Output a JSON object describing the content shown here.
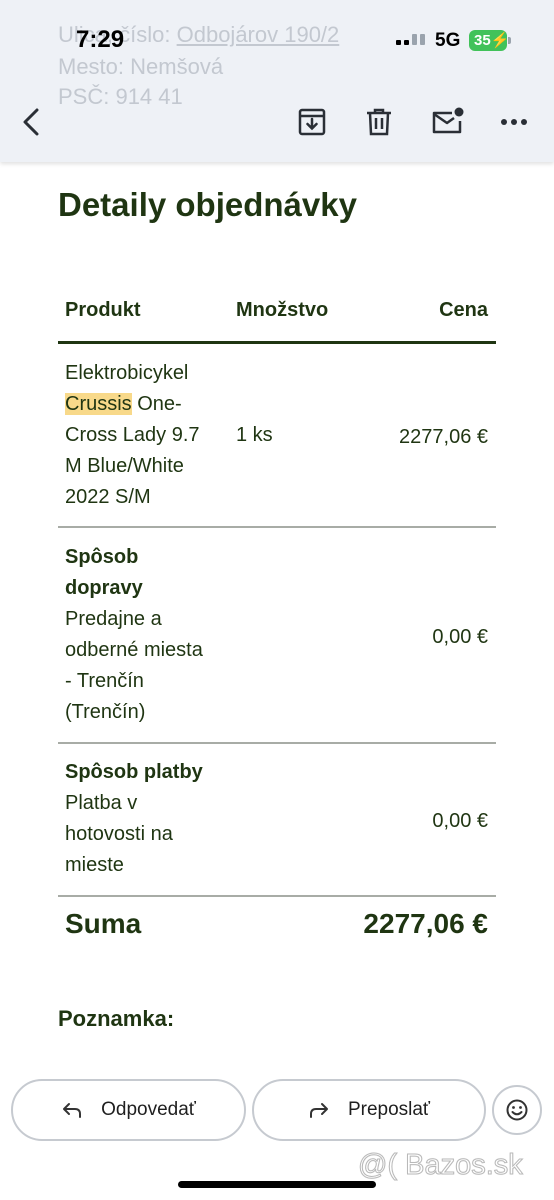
{
  "status_bar": {
    "time": "7:29",
    "network": "5G",
    "battery": "35"
  },
  "background_text": {
    "line1_prefix": "Ulica, číslo:",
    "line1_link": "Odbojárov 190/2",
    "line2": "Mesto: Nemšová",
    "line3": "PSČ: 914 41"
  },
  "toolbar": {
    "icons": [
      "back-arrow-icon",
      "archive-icon",
      "trash-icon",
      "mark-unread-icon",
      "more-icon"
    ]
  },
  "page": {
    "title": "Detaily objednávky"
  },
  "table": {
    "headers": {
      "product": "Produkt",
      "quantity": "Množstvo",
      "price": "Cena"
    },
    "product_row": {
      "line1": "Elektrobicykel",
      "highlight": "Crussis",
      "line2_rest": " One-",
      "line3": "Cross Lady 9.7",
      "line4": "M Blue/White",
      "line5": "2022 S/M",
      "quantity": "1 ks",
      "price": "2277,06 €"
    },
    "shipping_row": {
      "label_line1": "Spôsob",
      "label_line2": "dopravy",
      "value_line1": "Predajne a",
      "value_line2": "odberné miesta",
      "value_line3": "- Trenčín",
      "value_line4": "(Trenčín)",
      "price": "0,00 €"
    },
    "payment_row": {
      "label": "Spôsob platby",
      "value_line1": "Platba v",
      "value_line2": "hotovosti na",
      "value_line3": "mieste",
      "price": "0,00 €"
    },
    "total": {
      "label": "Suma",
      "value": "2277,06 €"
    }
  },
  "note": {
    "label": "Poznamka:"
  },
  "actions": {
    "reply_label": "Odpovedať",
    "forward_label": "Preposlať"
  },
  "watermark": "@( Bazos.sk"
}
